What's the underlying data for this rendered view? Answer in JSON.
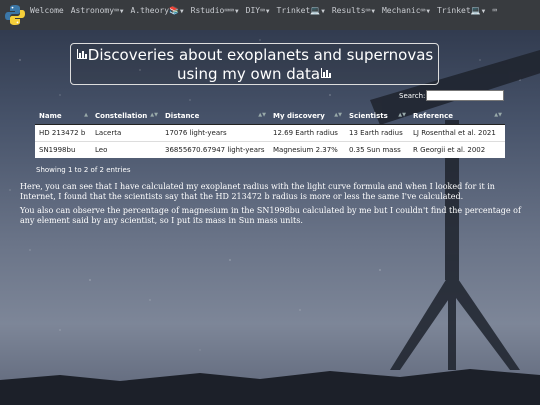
{
  "navbar": {
    "items": [
      {
        "label": "Welcome"
      },
      {
        "label": "Astronomy⌨︎"
      },
      {
        "label": "A.theory📚"
      },
      {
        "label": "Rstudio⌨︎⌨︎"
      },
      {
        "label": "DIY⌨︎"
      },
      {
        "label": "Trinket💻"
      },
      {
        "label": "Results⌨︎"
      },
      {
        "label": "Mechanic⌨︎"
      },
      {
        "label": "Trinket💻"
      },
      {
        "label": "⌨︎"
      }
    ]
  },
  "title": {
    "line1": "Discoveries about exoplanets and supernovas",
    "line2": "using my own data"
  },
  "search": {
    "label": "Search:",
    "value": "",
    "placeholder": ""
  },
  "table": {
    "headers": [
      "Name",
      "Constellation",
      "Distance",
      "My discovery",
      "Scientists",
      "Reference"
    ],
    "rows": [
      [
        "HD 213472 b",
        "Lacerta",
        "17076 light-years",
        "12.69 Earth radius",
        "13 Earth radius",
        "LJ Rosenthal et al. 2021"
      ],
      [
        "SN1998bu",
        "Leo",
        "36855670.67947 light-years",
        "Magnesium 2.37%",
        "0.35 Sun mass",
        "R Georgii et al. 2002"
      ]
    ],
    "info": "Showing 1 to 2 of 2 entries"
  },
  "paragraphs": [
    "Here, you can see that I have calculated my exoplanet radius with the light curve formula and when I looked for it in Internet, I found that the scientists say that the HD 213472 b radius is more or less the same I've calculated.",
    "You also can observe the percentage of magnesium in the SN1998bu calculated by me but I couldn't find the percentage of any element said by any scientist, so I put its mass in Sun mass units."
  ],
  "colors": {
    "navbar": "#383b3f",
    "text": "#ffffff",
    "row_bg": "#ffffff"
  },
  "icons": {
    "logo": "python-logo-icon",
    "title": "bar-chart-icon"
  }
}
